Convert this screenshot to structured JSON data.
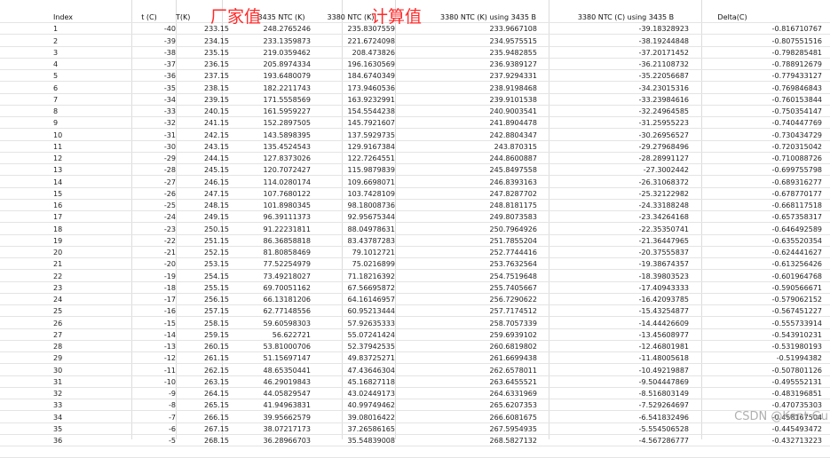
{
  "headers": [
    "Index",
    "t  (C)",
    "T(K)",
    "3435 NTC  (K)",
    "3380 NTC  (K)",
    "3380 NTC (K) using 3435 B",
    "3380 NTC (C) using 3435 B",
    "Delta(C)"
  ],
  "annotations": {
    "factory": "厂家值",
    "computed": "计算值"
  },
  "watermark": "CSDN @Kent Gu",
  "rows": [
    [
      "1",
      "-40",
      "233.15",
      "248.2765246",
      "235.8307559",
      "233.9667108",
      "-39.18328923",
      "-0.816710767"
    ],
    [
      "2",
      "-39",
      "234.15",
      "233.1359873",
      "221.6724098",
      "234.9575515",
      "-38.19244848",
      "-0.807551516"
    ],
    [
      "3",
      "-38",
      "235.15",
      "219.0359462",
      "208.473826",
      "235.9482855",
      "-37.20171452",
      "-0.798285481"
    ],
    [
      "4",
      "-37",
      "236.15",
      "205.8974334",
      "196.1630569",
      "236.9389127",
      "-36.21108732",
      "-0.788912679"
    ],
    [
      "5",
      "-36",
      "237.15",
      "193.6480079",
      "184.6740349",
      "237.9294331",
      "-35.22056687",
      "-0.779433127"
    ],
    [
      "6",
      "-35",
      "238.15",
      "182.2211743",
      "173.9460536",
      "238.9198468",
      "-34.23015316",
      "-0.769846843"
    ],
    [
      "7",
      "-34",
      "239.15",
      "171.5558569",
      "163.9232991",
      "239.9101538",
      "-33.23984616",
      "-0.760153844"
    ],
    [
      "8",
      "-33",
      "240.15",
      "161.5959227",
      "154.5544238",
      "240.9003541",
      "-32.24964585",
      "-0.750354147"
    ],
    [
      "9",
      "-32",
      "241.15",
      "152.2897505",
      "145.7921607",
      "241.8904478",
      "-31.25955223",
      "-0.740447769"
    ],
    [
      "10",
      "-31",
      "242.15",
      "143.5898395",
      "137.5929735",
      "242.8804347",
      "-30.26956527",
      "-0.730434729"
    ],
    [
      "11",
      "-30",
      "243.15",
      "135.4524543",
      "129.9167384",
      "243.870315",
      "-29.27968496",
      "-0.720315042"
    ],
    [
      "12",
      "-29",
      "244.15",
      "127.8373026",
      "122.7264551",
      "244.8600887",
      "-28.28991127",
      "-0.710088726"
    ],
    [
      "13",
      "-28",
      "245.15",
      "120.7072427",
      "115.9879839",
      "245.8497558",
      "-27.3002442",
      "-0.699755798"
    ],
    [
      "14",
      "-27",
      "246.15",
      "114.0280174",
      "109.6698071",
      "246.8393163",
      "-26.31068372",
      "-0.689316277"
    ],
    [
      "15",
      "-26",
      "247.15",
      "107.7680122",
      "103.7428109",
      "247.8287702",
      "-25.32122982",
      "-0.678770177"
    ],
    [
      "16",
      "-25",
      "248.15",
      "101.8980345",
      "98.18008736",
      "248.8181175",
      "-24.33188248",
      "-0.668117518"
    ],
    [
      "17",
      "-24",
      "249.15",
      "96.39111373",
      "92.95675344",
      "249.8073583",
      "-23.34264168",
      "-0.657358317"
    ],
    [
      "18",
      "-23",
      "250.15",
      "91.22231811",
      "88.04978631",
      "250.7964926",
      "-22.35350741",
      "-0.646492589"
    ],
    [
      "19",
      "-22",
      "251.15",
      "86.36858818",
      "83.43787283",
      "251.7855204",
      "-21.36447965",
      "-0.635520354"
    ],
    [
      "20",
      "-21",
      "252.15",
      "81.80858469",
      "79.1012721",
      "252.7744416",
      "-20.37555837",
      "-0.624441627"
    ],
    [
      "21",
      "-20",
      "253.15",
      "77.52254979",
      "75.0216899",
      "253.7632564",
      "-19.38674357",
      "-0.613256426"
    ],
    [
      "22",
      "-19",
      "254.15",
      "73.49218027",
      "71.18216392",
      "254.7519648",
      "-18.39803523",
      "-0.601964768"
    ],
    [
      "23",
      "-18",
      "255.15",
      "69.70051162",
      "67.56695872",
      "255.7405667",
      "-17.40943333",
      "-0.590566671"
    ],
    [
      "24",
      "-17",
      "256.15",
      "66.13181206",
      "64.16146957",
      "256.7290622",
      "-16.42093785",
      "-0.579062152"
    ],
    [
      "25",
      "-16",
      "257.15",
      "62.77148556",
      "60.95213444",
      "257.7174512",
      "-15.43254877",
      "-0.567451227"
    ],
    [
      "26",
      "-15",
      "258.15",
      "59.60598303",
      "57.92635333",
      "258.7057339",
      "-14.44426609",
      "-0.555733914"
    ],
    [
      "27",
      "-14",
      "259.15",
      "56.622721",
      "55.07241424",
      "259.6939102",
      "-13.45608977",
      "-0.543910231"
    ],
    [
      "28",
      "-13",
      "260.15",
      "53.81000706",
      "52.37942535",
      "260.6819802",
      "-12.46801981",
      "-0.531980193"
    ],
    [
      "29",
      "-12",
      "261.15",
      "51.15697147",
      "49.83725271",
      "261.6699438",
      "-11.48005618",
      "-0.51994382"
    ],
    [
      "30",
      "-11",
      "262.15",
      "48.65350441",
      "47.43646304",
      "262.6578011",
      "-10.49219887",
      "-0.507801126"
    ],
    [
      "31",
      "-10",
      "263.15",
      "46.29019843",
      "45.16827118",
      "263.6455521",
      "-9.504447869",
      "-0.495552131"
    ],
    [
      "32",
      "-9",
      "264.15",
      "44.05829547",
      "43.02449173",
      "264.6331969",
      "-8.516803149",
      "-0.483196851"
    ],
    [
      "33",
      "-8",
      "265.15",
      "41.94963831",
      "40.99749462",
      "265.6207353",
      "-7.529264697",
      "-0.470735303"
    ],
    [
      "34",
      "-7",
      "266.15",
      "39.95662579",
      "39.08016422",
      "266.6081675",
      "-6.541832496",
      "-0.458167504"
    ],
    [
      "35",
      "-6",
      "267.15",
      "38.07217173",
      "37.26586165",
      "267.5954935",
      "-5.554506528",
      "-0.445493472"
    ],
    [
      "36",
      "-5",
      "268.15",
      "36.28966703",
      "35.54839008",
      "268.5827132",
      "-4.567286777",
      "-0.432713223"
    ]
  ]
}
